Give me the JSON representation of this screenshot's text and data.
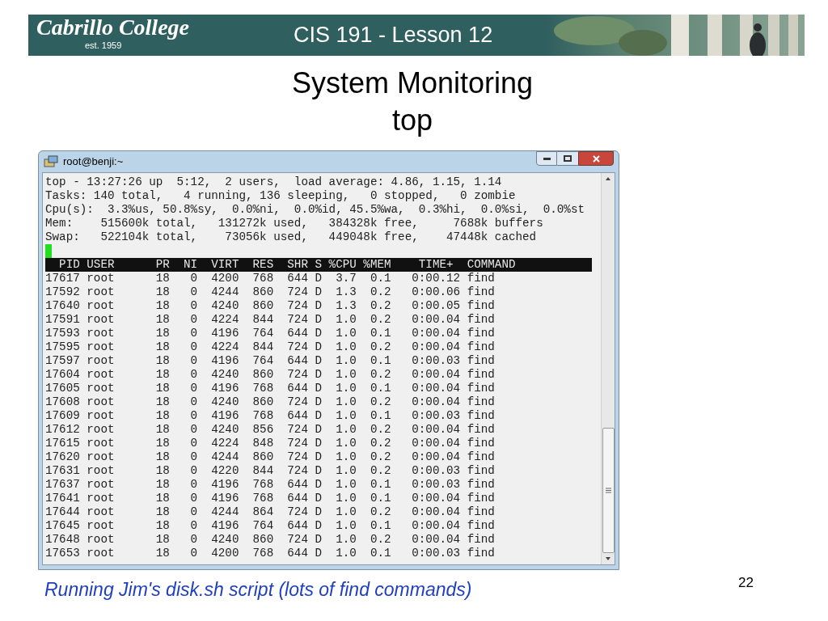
{
  "banner": {
    "logo_name": "Cabrillo College",
    "logo_est": "est. 1959",
    "title": "CIS 191 - Lesson 12"
  },
  "heading": [
    "System Monitoring",
    "top"
  ],
  "window": {
    "title": "root@benji:~",
    "summary_lines": [
      "top - 13:27:26 up  5:12,  2 users,  load average: 4.86, 1.15, 1.14",
      "Tasks: 140 total,   4 running, 136 sleeping,   0 stopped,   0 zombie",
      "Cpu(s):  3.3%us, 50.8%sy,  0.0%ni,  0.0%id, 45.5%wa,  0.3%hi,  0.0%si,  0.0%st",
      "Mem:    515600k total,   131272k used,   384328k free,     7688k buffers",
      "Swap:   522104k total,    73056k used,   449048k free,    47448k cached"
    ],
    "process_header": "  PID USER      PR  NI  VIRT  RES  SHR S %CPU %MEM    TIME+  COMMAND",
    "process_lines": [
      "17617 root      18   0  4200  768  644 D  3.7  0.1   0:00.12 find",
      "17592 root      18   0  4244  860  724 D  1.3  0.2   0:00.06 find",
      "17640 root      18   0  4240  860  724 D  1.3  0.2   0:00.05 find",
      "17591 root      18   0  4224  844  724 D  1.0  0.2   0:00.04 find",
      "17593 root      18   0  4196  764  644 D  1.0  0.1   0:00.04 find",
      "17595 root      18   0  4224  844  724 D  1.0  0.2   0:00.04 find",
      "17597 root      18   0  4196  764  644 D  1.0  0.1   0:00.03 find",
      "17604 root      18   0  4240  860  724 D  1.0  0.2   0:00.04 find",
      "17605 root      18   0  4196  768  644 D  1.0  0.1   0:00.04 find",
      "17608 root      18   0  4240  860  724 D  1.0  0.2   0:00.04 find",
      "17609 root      18   0  4196  768  644 D  1.0  0.1   0:00.03 find",
      "17612 root      18   0  4240  856  724 D  1.0  0.2   0:00.04 find",
      "17615 root      18   0  4224  848  724 D  1.0  0.2   0:00.04 find",
      "17620 root      18   0  4244  860  724 D  1.0  0.2   0:00.04 find",
      "17631 root      18   0  4220  844  724 D  1.0  0.2   0:00.03 find",
      "17637 root      18   0  4196  768  644 D  1.0  0.1   0:00.03 find",
      "17641 root      18   0  4196  768  644 D  1.0  0.1   0:00.04 find",
      "17644 root      18   0  4244  864  724 D  1.0  0.2   0:00.04 find",
      "17645 root      18   0  4196  764  644 D  1.0  0.1   0:00.04 find",
      "17648 root      18   0  4240  860  724 D  1.0  0.2   0:00.04 find",
      "17653 root      18   0  4200  768  644 D  1.0  0.1   0:00.03 find"
    ]
  },
  "caption": "Running Jim's disk.sh script  (lots of find commands)",
  "page_number": "22"
}
